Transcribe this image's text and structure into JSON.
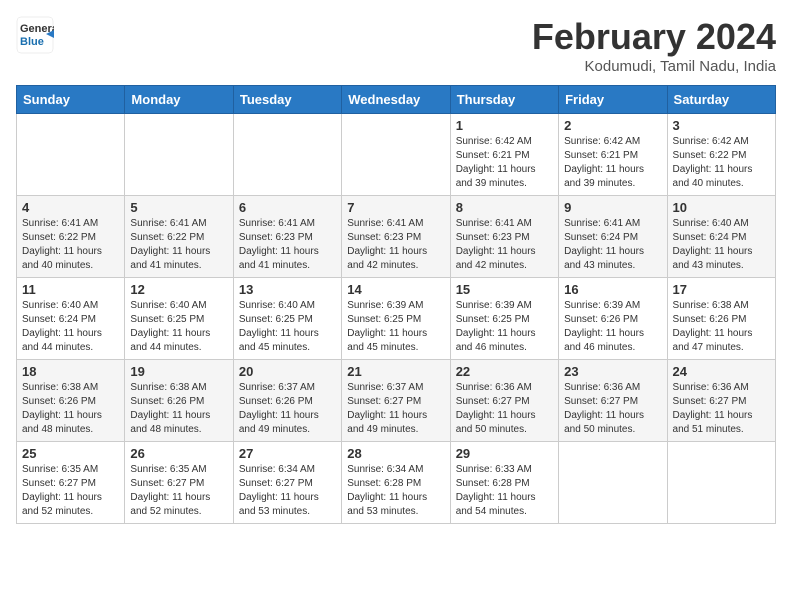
{
  "header": {
    "logo_line1": "General",
    "logo_line2": "Blue",
    "month_title": "February 2024",
    "location": "Kodumudi, Tamil Nadu, India"
  },
  "weekdays": [
    "Sunday",
    "Monday",
    "Tuesday",
    "Wednesday",
    "Thursday",
    "Friday",
    "Saturday"
  ],
  "weeks": [
    [
      {
        "day": "",
        "info": ""
      },
      {
        "day": "",
        "info": ""
      },
      {
        "day": "",
        "info": ""
      },
      {
        "day": "",
        "info": ""
      },
      {
        "day": "1",
        "info": "Sunrise: 6:42 AM\nSunset: 6:21 PM\nDaylight: 11 hours and 39 minutes."
      },
      {
        "day": "2",
        "info": "Sunrise: 6:42 AM\nSunset: 6:21 PM\nDaylight: 11 hours and 39 minutes."
      },
      {
        "day": "3",
        "info": "Sunrise: 6:42 AM\nSunset: 6:22 PM\nDaylight: 11 hours and 40 minutes."
      }
    ],
    [
      {
        "day": "4",
        "info": "Sunrise: 6:41 AM\nSunset: 6:22 PM\nDaylight: 11 hours and 40 minutes."
      },
      {
        "day": "5",
        "info": "Sunrise: 6:41 AM\nSunset: 6:22 PM\nDaylight: 11 hours and 41 minutes."
      },
      {
        "day": "6",
        "info": "Sunrise: 6:41 AM\nSunset: 6:23 PM\nDaylight: 11 hours and 41 minutes."
      },
      {
        "day": "7",
        "info": "Sunrise: 6:41 AM\nSunset: 6:23 PM\nDaylight: 11 hours and 42 minutes."
      },
      {
        "day": "8",
        "info": "Sunrise: 6:41 AM\nSunset: 6:23 PM\nDaylight: 11 hours and 42 minutes."
      },
      {
        "day": "9",
        "info": "Sunrise: 6:41 AM\nSunset: 6:24 PM\nDaylight: 11 hours and 43 minutes."
      },
      {
        "day": "10",
        "info": "Sunrise: 6:40 AM\nSunset: 6:24 PM\nDaylight: 11 hours and 43 minutes."
      }
    ],
    [
      {
        "day": "11",
        "info": "Sunrise: 6:40 AM\nSunset: 6:24 PM\nDaylight: 11 hours and 44 minutes."
      },
      {
        "day": "12",
        "info": "Sunrise: 6:40 AM\nSunset: 6:25 PM\nDaylight: 11 hours and 44 minutes."
      },
      {
        "day": "13",
        "info": "Sunrise: 6:40 AM\nSunset: 6:25 PM\nDaylight: 11 hours and 45 minutes."
      },
      {
        "day": "14",
        "info": "Sunrise: 6:39 AM\nSunset: 6:25 PM\nDaylight: 11 hours and 45 minutes."
      },
      {
        "day": "15",
        "info": "Sunrise: 6:39 AM\nSunset: 6:25 PM\nDaylight: 11 hours and 46 minutes."
      },
      {
        "day": "16",
        "info": "Sunrise: 6:39 AM\nSunset: 6:26 PM\nDaylight: 11 hours and 46 minutes."
      },
      {
        "day": "17",
        "info": "Sunrise: 6:38 AM\nSunset: 6:26 PM\nDaylight: 11 hours and 47 minutes."
      }
    ],
    [
      {
        "day": "18",
        "info": "Sunrise: 6:38 AM\nSunset: 6:26 PM\nDaylight: 11 hours and 48 minutes."
      },
      {
        "day": "19",
        "info": "Sunrise: 6:38 AM\nSunset: 6:26 PM\nDaylight: 11 hours and 48 minutes."
      },
      {
        "day": "20",
        "info": "Sunrise: 6:37 AM\nSunset: 6:26 PM\nDaylight: 11 hours and 49 minutes."
      },
      {
        "day": "21",
        "info": "Sunrise: 6:37 AM\nSunset: 6:27 PM\nDaylight: 11 hours and 49 minutes."
      },
      {
        "day": "22",
        "info": "Sunrise: 6:36 AM\nSunset: 6:27 PM\nDaylight: 11 hours and 50 minutes."
      },
      {
        "day": "23",
        "info": "Sunrise: 6:36 AM\nSunset: 6:27 PM\nDaylight: 11 hours and 50 minutes."
      },
      {
        "day": "24",
        "info": "Sunrise: 6:36 AM\nSunset: 6:27 PM\nDaylight: 11 hours and 51 minutes."
      }
    ],
    [
      {
        "day": "25",
        "info": "Sunrise: 6:35 AM\nSunset: 6:27 PM\nDaylight: 11 hours and 52 minutes."
      },
      {
        "day": "26",
        "info": "Sunrise: 6:35 AM\nSunset: 6:27 PM\nDaylight: 11 hours and 52 minutes."
      },
      {
        "day": "27",
        "info": "Sunrise: 6:34 AM\nSunset: 6:27 PM\nDaylight: 11 hours and 53 minutes."
      },
      {
        "day": "28",
        "info": "Sunrise: 6:34 AM\nSunset: 6:28 PM\nDaylight: 11 hours and 53 minutes."
      },
      {
        "day": "29",
        "info": "Sunrise: 6:33 AM\nSunset: 6:28 PM\nDaylight: 11 hours and 54 minutes."
      },
      {
        "day": "",
        "info": ""
      },
      {
        "day": "",
        "info": ""
      }
    ]
  ]
}
